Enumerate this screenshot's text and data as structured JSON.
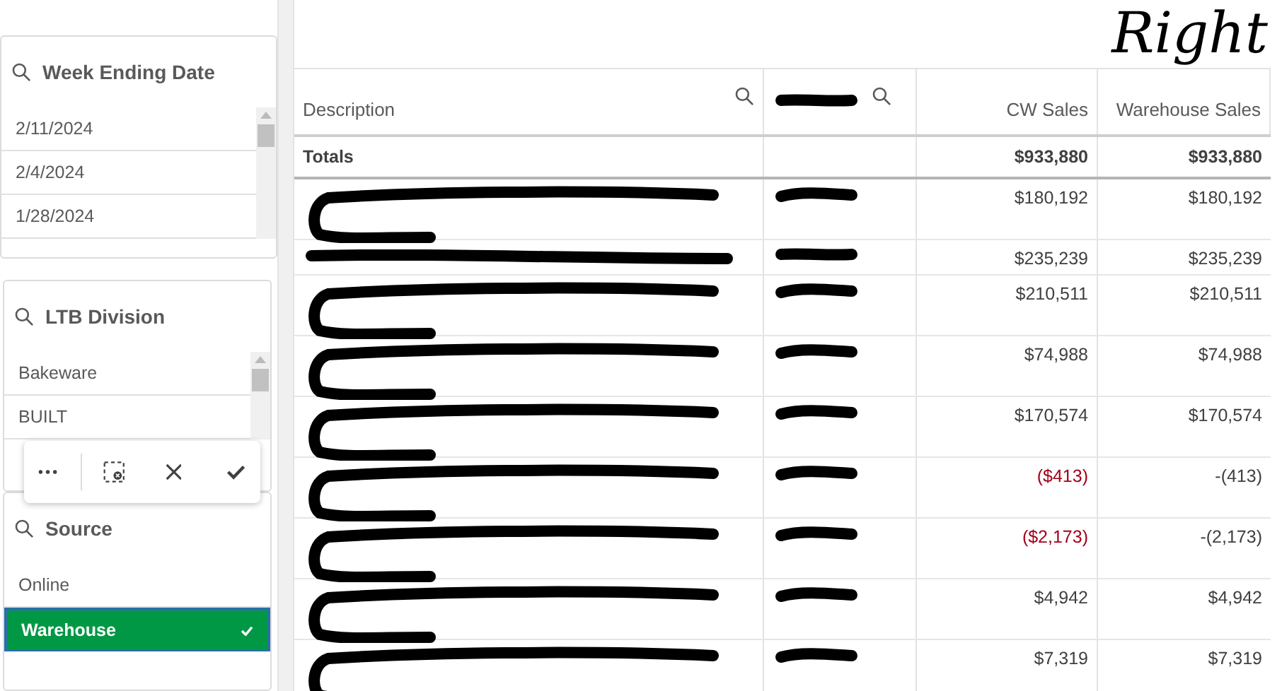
{
  "annotation": "Right",
  "filters": [
    {
      "title": "Week Ending Date",
      "items": [
        {
          "label": "2/11/2024",
          "selected": false
        },
        {
          "label": "2/4/2024",
          "selected": false
        },
        {
          "label": "1/28/2024",
          "selected": false
        }
      ]
    },
    {
      "title": "LTB Division",
      "items": [
        {
          "label": "Bakeware",
          "selected": false
        },
        {
          "label": "BUILT",
          "selected": false
        }
      ]
    },
    {
      "title": "Source",
      "items": [
        {
          "label": "Online",
          "selected": false
        },
        {
          "label": "Warehouse",
          "selected": true
        }
      ]
    }
  ],
  "table": {
    "columns": [
      {
        "label": "Description",
        "searchable": true
      },
      {
        "searchable": true,
        "redacted": true
      },
      {
        "label": "CW Sales",
        "searchable": false
      },
      {
        "label": "Warehouse Sales",
        "searchable": false
      }
    ],
    "totals": {
      "label": "Totals",
      "cw_sales": "$933,880",
      "warehouse_sales": "$933,880"
    },
    "rows": [
      {
        "kind": "hook",
        "cw_sales": "$180,192",
        "cw_negative": false,
        "warehouse_sales": "$180,192"
      },
      {
        "kind": "stroke",
        "cw_sales": "$235,239",
        "cw_negative": false,
        "warehouse_sales": "$235,239"
      },
      {
        "kind": "hook",
        "cw_sales": "$210,511",
        "cw_negative": false,
        "warehouse_sales": "$210,511"
      },
      {
        "kind": "hook",
        "cw_sales": "$74,988",
        "cw_negative": false,
        "warehouse_sales": "$74,988"
      },
      {
        "kind": "hook",
        "cw_sales": "$170,574",
        "cw_negative": false,
        "warehouse_sales": "$170,574"
      },
      {
        "kind": "hook",
        "cw_sales": "($413)",
        "cw_negative": true,
        "warehouse_sales": "-(413)"
      },
      {
        "kind": "hook",
        "cw_sales": "($2,173)",
        "cw_negative": true,
        "warehouse_sales": "-(2,173)"
      },
      {
        "kind": "hook",
        "cw_sales": "$4,942",
        "cw_negative": false,
        "warehouse_sales": "$4,942"
      },
      {
        "kind": "hook",
        "cw_sales": "$7,319",
        "cw_negative": false,
        "warehouse_sales": "$7,319"
      }
    ]
  }
}
